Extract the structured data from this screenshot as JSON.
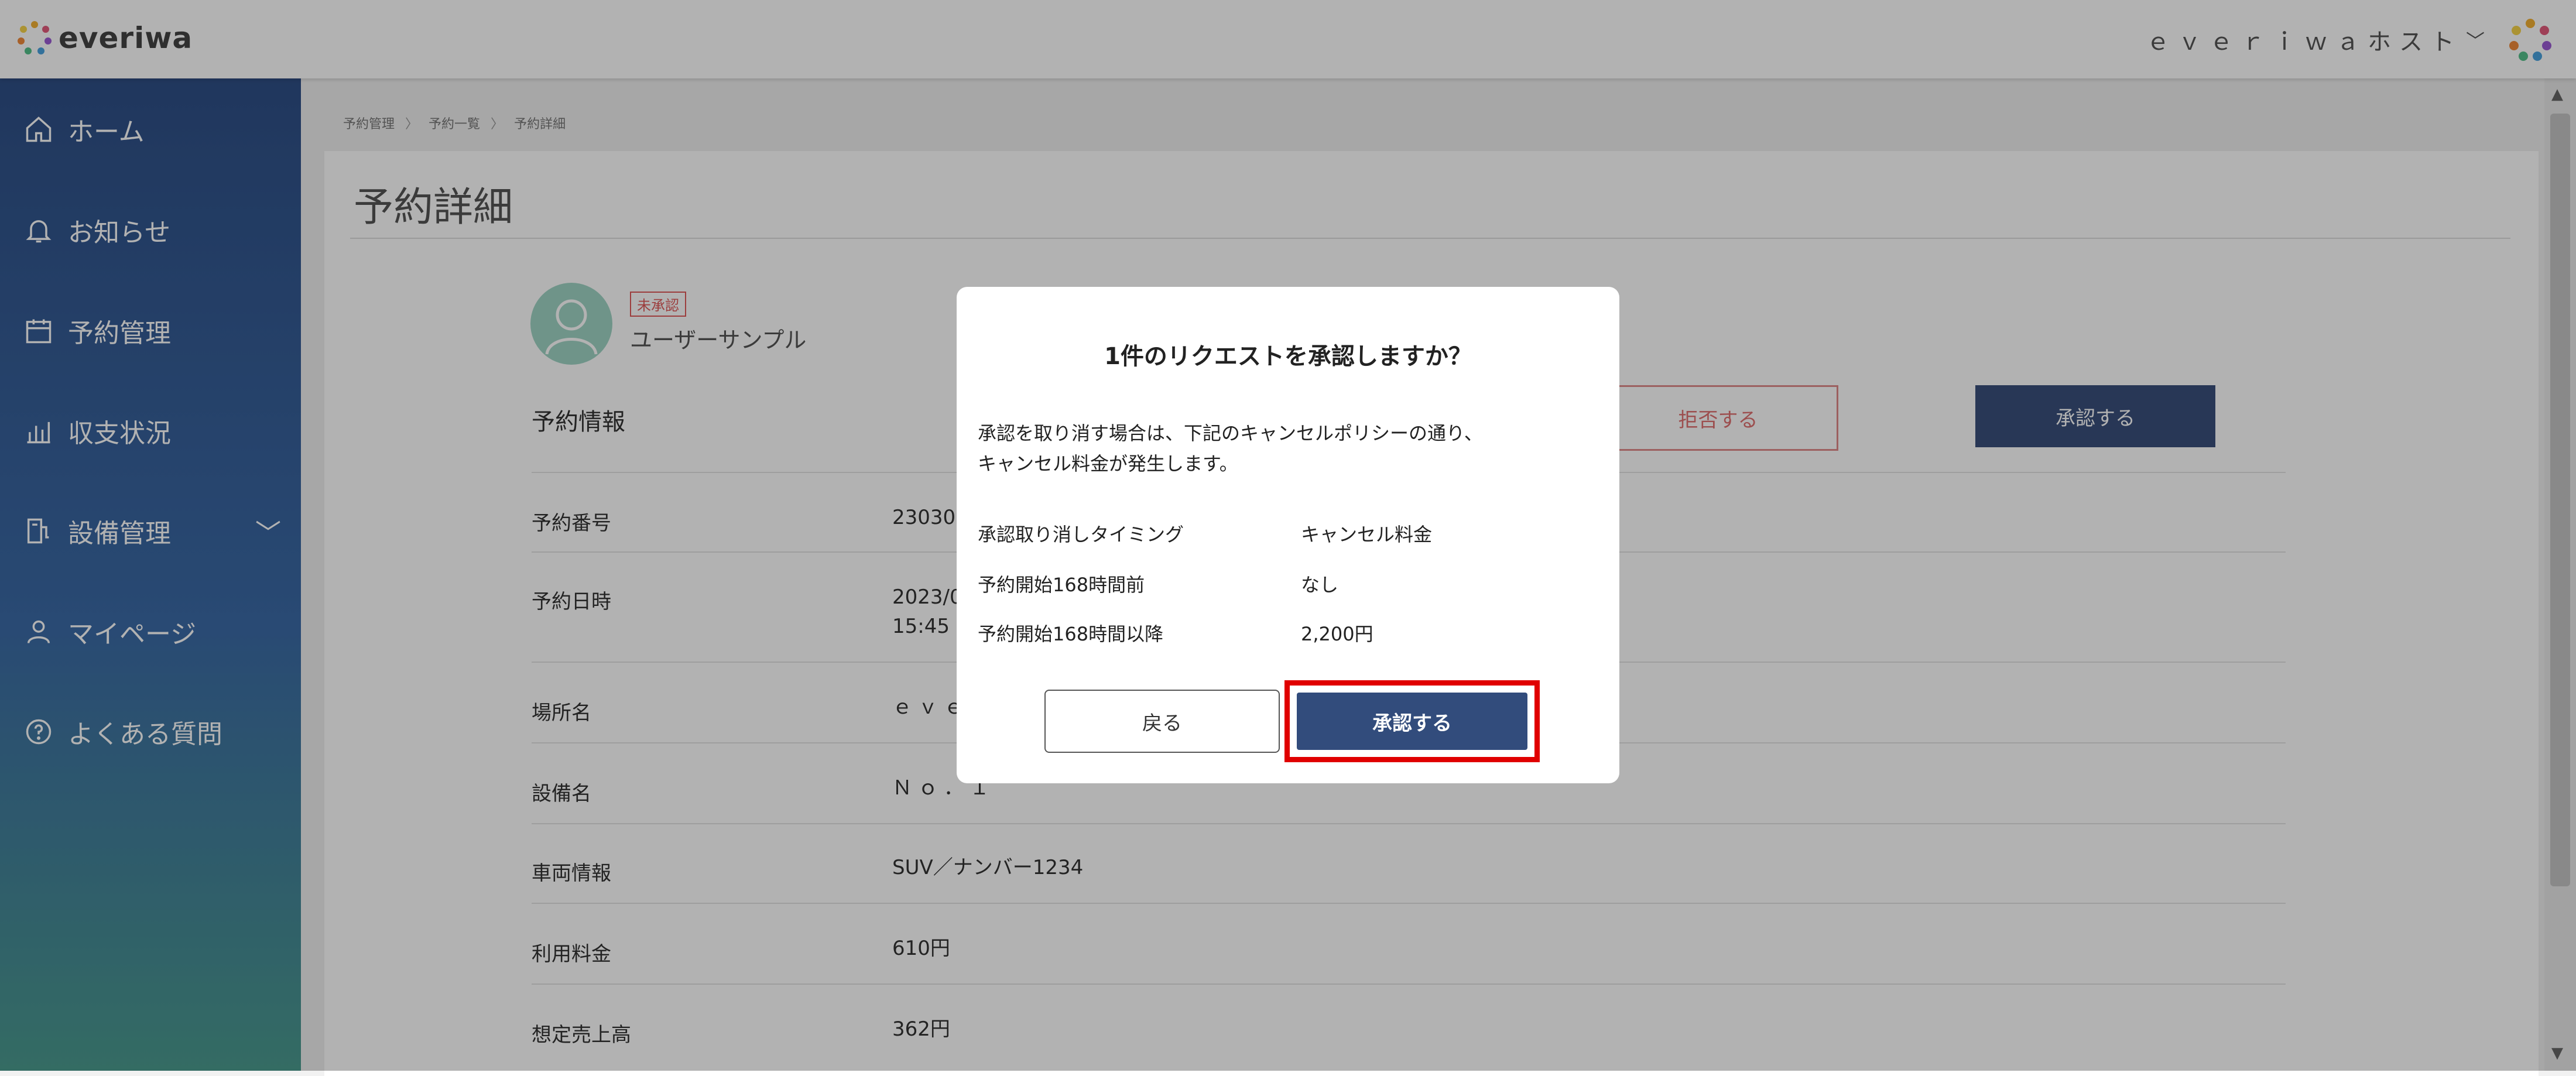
{
  "header": {
    "logo_text": "everiwa",
    "user_name": "ｅｖｅｒｉｗａホスト",
    "chevron": "﹀"
  },
  "sidebar": {
    "items": [
      {
        "label": "ホーム",
        "icon": "home-icon"
      },
      {
        "label": "お知らせ",
        "icon": "bell-icon"
      },
      {
        "label": "予約管理",
        "icon": "calendar-icon"
      },
      {
        "label": "収支状況",
        "icon": "chart-icon"
      },
      {
        "label": "設備管理",
        "icon": "equipment-icon"
      },
      {
        "label": "マイページ",
        "icon": "person-icon"
      },
      {
        "label": "よくある質問",
        "icon": "help-icon"
      }
    ],
    "caret": "﹀"
  },
  "breadcrumb": [
    "予約管理",
    "予約一覧",
    "予約詳細"
  ],
  "page": {
    "title": "予約詳細",
    "badge": "未承認",
    "user_name": "ユーザーサンプル",
    "section_title": "予約情報",
    "reject_label": "拒否する",
    "approve_label": "承認する",
    "rows": [
      {
        "label": "予約番号",
        "value": "230309"
      },
      {
        "label": "予約日時",
        "value": "2023/0",
        "value2": "15:45 ~"
      },
      {
        "label": "場所名",
        "value": "ｅｖｅ"
      },
      {
        "label": "設備名",
        "value": "Ｎｏ．１"
      },
      {
        "label": "車両情報",
        "value": "SUV／ナンバー1234"
      },
      {
        "label": "利用料金",
        "value": "610円"
      },
      {
        "label": "想定売上高",
        "value": "362円"
      }
    ]
  },
  "modal": {
    "title": "1件のリクエストを承認しますか？",
    "message_line1": "承認を取り消す場合は、下記のキャンセルポリシーの通り、",
    "message_line2": "キャンセル料金が発生します。",
    "policy_header": {
      "timing": "承認取り消しタイミング",
      "fee": "キャンセル料金"
    },
    "policy_rows": [
      {
        "timing": "予約開始168時間前",
        "fee": "なし"
      },
      {
        "timing": "予約開始168時間以降",
        "fee": "2,200円"
      }
    ],
    "back_label": "戻る",
    "confirm_label": "承認する"
  },
  "colors": {
    "accent": "#324c7c",
    "highlight": "#e00000",
    "reject": "#e07070",
    "badge": "#e05a5a"
  }
}
